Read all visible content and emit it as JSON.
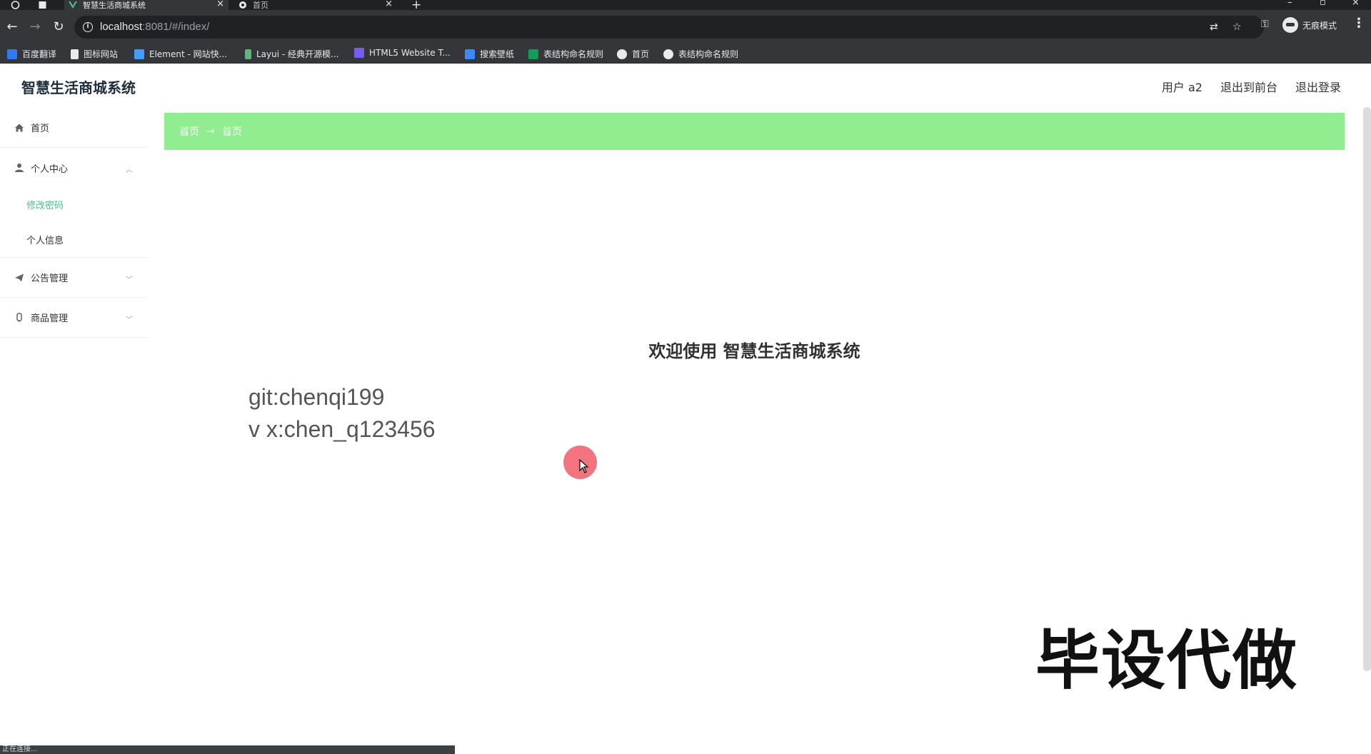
{
  "browser": {
    "tabs": [
      {
        "title": "智慧生活商城系统",
        "active": true
      },
      {
        "title": "首页",
        "active": false
      }
    ],
    "url_host": "localhost",
    "url_rest": ":8081/#/index/",
    "profile_label": "无痕模式",
    "bookmarks": [
      "百度翻译",
      "图标网站",
      "Element - 网站快...",
      "Layui - 经典开源模...",
      "HTML5 Website T...",
      "搜索壁纸",
      "表结构命名规则",
      "首页",
      "表结构命名规则"
    ],
    "status_text": "正在连接..."
  },
  "header": {
    "title": "智慧生活商城系统",
    "user_label": "用户 a2",
    "to_front_label": "退出到前台",
    "logout_label": "退出登录"
  },
  "sidebar": {
    "home": "首页",
    "personal_center": "个人中心",
    "change_password": "修改密码",
    "personal_info": "个人信息",
    "announcements": "公告管理",
    "products": "商品管理"
  },
  "breadcrumb": [
    "首页",
    "首页"
  ],
  "main": {
    "welcome": "欢迎使用 智慧生活商城系统",
    "git_line": "git:chenqi199",
    "wx_line": "v x:chen_q123456",
    "stamp": "毕设代做"
  },
  "colors": {
    "accent": "#4fc08d",
    "breadcrumb_bg": "#90ee90"
  }
}
